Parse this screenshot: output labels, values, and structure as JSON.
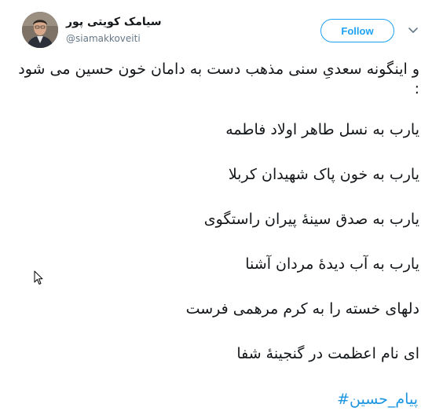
{
  "tweet": {
    "author": {
      "display_name": "سیامک کویتی پور",
      "handle": "@siamakkoveiti"
    },
    "follow_label": "Follow",
    "intro": "و اینگونه سعدیِ سنی مذهب دست به دامان خون حسین می شود :",
    "verses": [
      "یارب به نسل طاهر اولاد فاطمه",
      "یارب به خون پاک شهیدان کربلا",
      "یارب به صدق سینهٔ پیران راستگوی",
      "یارب به آب دیدهٔ مردان آشنا",
      "دلهای خسته را به کرم مرهمی فرست",
      "ای نام اعظمت در گنجینهٔ شفا"
    ],
    "hashtag": "#پیام_حسین"
  },
  "icons": {
    "more": "chevron-down-icon",
    "pointer": "mouse-cursor-icon"
  },
  "colors": {
    "accent": "#1da1f2",
    "hashtag": "#1b95e0",
    "text": "#14171a",
    "secondary": "#657786"
  }
}
